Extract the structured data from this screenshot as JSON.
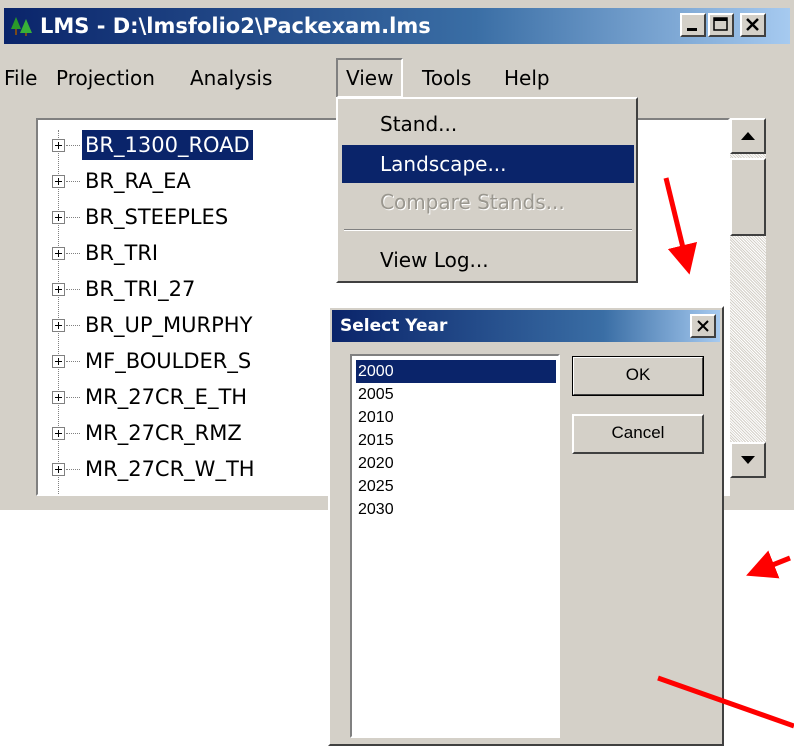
{
  "window": {
    "title": "LMS - D:\\lmsfolio2\\Packexam.lms",
    "menu": [
      "File",
      "Projection",
      "Analysis",
      "View",
      "Tools",
      "Help"
    ]
  },
  "tree": {
    "items": [
      "BR_1300_ROAD",
      "BR_RA_EA",
      "BR_STEEPLES",
      "BR_TRI",
      "BR_TRI_27",
      "BR_UP_MURPHY",
      "MF_BOULDER_S",
      "MR_27CR_E_TH",
      "MR_27CR_RMZ",
      "MR_27CR_W_TH"
    ]
  },
  "view_menu": {
    "items": [
      "Stand...",
      "Landscape...",
      "Compare Stands...",
      "View Log..."
    ]
  },
  "dialog": {
    "title": "Select Year",
    "years": [
      "2000",
      "2005",
      "2010",
      "2015",
      "2020",
      "2025",
      "2030"
    ],
    "ok_label": "OK",
    "cancel_label": "Cancel"
  },
  "colors": {
    "selection": "#0a246a",
    "annotation_arrow": "#ff0000",
    "window_bg": "#d4d0c8"
  }
}
